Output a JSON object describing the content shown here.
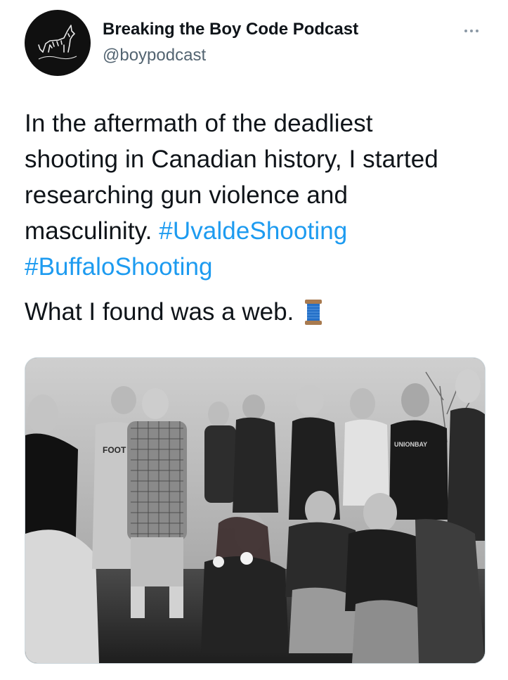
{
  "author": {
    "display_name": "Breaking the Boy Code Podcast",
    "handle": "@boypodcast",
    "avatar_icon": "wolf-howling-icon"
  },
  "tweet": {
    "text_lines": [
      "In the aftermath of the deadliest",
      "shooting in Canadian history, I started",
      "researching gun violence and",
      "masculinity."
    ],
    "hashtags": [
      "#UvaldeShooting",
      "#BuffaloShooting"
    ],
    "second_paragraph": "What I found was a web.",
    "emoji_icon": "spool-of-thread-icon"
  },
  "media": {
    "kind": "black-and-white photograph",
    "sweatshirt_text": "FOOT",
    "shirt_text": "UNIONBAY"
  },
  "colors": {
    "text": "#0f1419",
    "secondary": "#536471",
    "link": "#1d9bf0"
  }
}
